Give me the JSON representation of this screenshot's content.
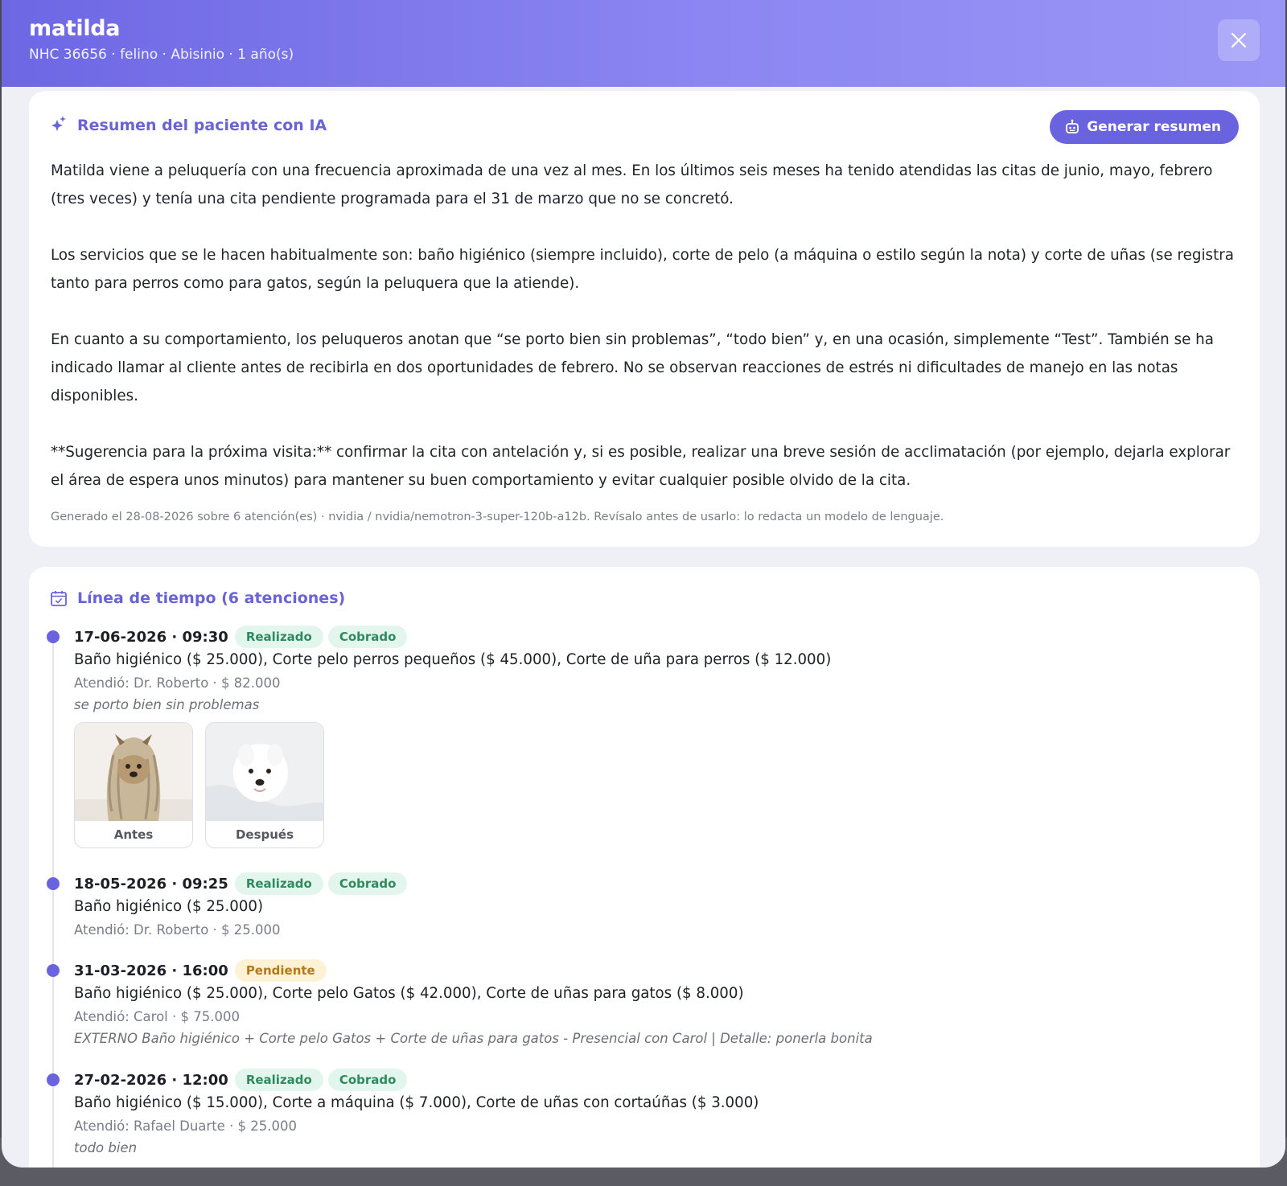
{
  "header": {
    "pet_name": "matilda",
    "pet_meta": "NHC 36656 · felino · Abisinio · 1 año(s)"
  },
  "summary": {
    "title": "Resumen del paciente con IA",
    "generate_button": "Generar resumen",
    "paragraphs": [
      "Matilda viene a peluquería con una frecuencia aproximada de una vez al mes. En los últimos seis meses ha tenido atendidas las citas de junio, mayo, febrero (tres veces) y tenía una cita pendiente programada para el 31 de marzo que no se concretó.",
      "Los servicios que se le hacen habitualmente son: baño higiénico (siempre incluido), corte de pelo (a máquina o estilo según la nota) y corte de uñas (se registra tanto para perros como para gatos, según la peluquera que la atiende).",
      "En cuanto a su comportamiento, los peluqueros anotan que “se porto bien sin problemas”, “todo bien” y, en una ocasión, simplemente “Test”. También se ha indicado llamar al cliente antes de recibirla en dos oportunidades de febrero. No se observan reacciones de estrés ni dificultades de manejo en las notas disponibles.",
      "**Sugerencia para la próxima visita:** confirmar la cita con antelación y, si es posible, realizar una breve sesión de acclimatación (por ejemplo, dejarla explorar el área de espera unos minutos) para mantener su buen comportamiento y evitar cualquier posible olvido de la cita."
    ],
    "footer": "Generado el 28-08-2026 sobre 6 atención(es) · nvidia / nvidia/nemotron-3-super-120b-a12b. Revísalo antes de usarlo: lo redacta un modelo de lenguaje."
  },
  "timeline": {
    "title": "Línea de tiempo (6 atenciones)",
    "items": [
      {
        "datetime": "17-06-2026 · 09:30",
        "badges": [
          "Realizado",
          "Cobrado"
        ],
        "services": "Baño higiénico ($ 25.000), Corte pelo perros pequeños ($ 45.000), Corte de uña para perros ($ 12.000)",
        "attended": "Atendió: Dr. Roberto · $ 82.000",
        "note": "se porto bien sin problemas",
        "photos": [
          "Antes",
          "Después"
        ]
      },
      {
        "datetime": "18-05-2026 · 09:25",
        "badges": [
          "Realizado",
          "Cobrado"
        ],
        "services": "Baño higiénico ($ 25.000)",
        "attended": "Atendió: Dr. Roberto · $ 25.000"
      },
      {
        "datetime": "31-03-2026 · 16:00",
        "badges": [
          "Pendiente"
        ],
        "services": "Baño higiénico ($ 25.000), Corte pelo Gatos ($ 42.000), Corte de uñas para gatos ($ 8.000)",
        "attended": "Atendió: Carol · $ 75.000",
        "note": "EXTERNO Baño higiénico + Corte pelo Gatos + Corte de uñas para gatos - Presencial con Carol | Detalle: ponerla bonita"
      },
      {
        "datetime": "27-02-2026 · 12:00",
        "badges": [
          "Realizado",
          "Cobrado"
        ],
        "services": "Baño higiénico ($ 15.000), Corte a máquina ($ 7.000), Corte de uñas con cortaúñas ($ 3.000)",
        "attended": "Atendió: Rafael Duarte · $ 25.000",
        "note": "todo bien"
      }
    ]
  },
  "colors": {
    "accent": "#6a63e0",
    "header_gradient_start": "#6e67e4",
    "header_gradient_end": "#9a96f6",
    "badge_green_bg": "#e3f6ee",
    "badge_green_text": "#2f8a5f",
    "badge_yellow_bg": "#fdf2d6",
    "badge_yellow_text": "#b47a12"
  },
  "icons": {
    "close": "close-icon",
    "sparkles": "sparkles-icon",
    "robot": "robot-icon",
    "calendar": "calendar-check-icon"
  }
}
